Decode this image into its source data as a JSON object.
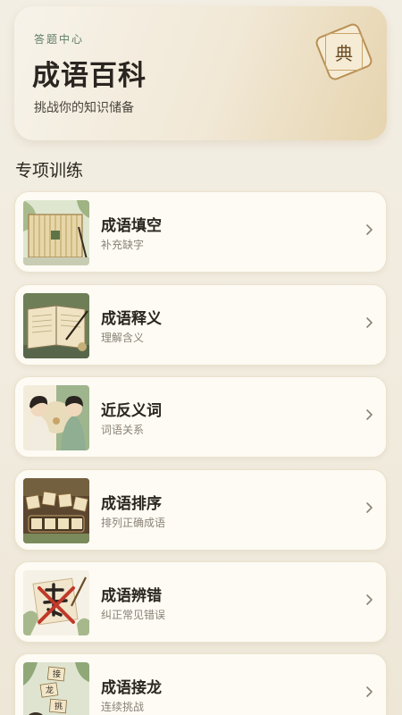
{
  "hero": {
    "kicker": "答题中心",
    "title": "成语百科",
    "subtitle": "挑战你的知识储备",
    "seal_char": "典"
  },
  "section_title": "专项训练",
  "items": [
    {
      "title": "成语填空",
      "subtitle": "补充缺字",
      "icon": "bamboo-scroll-blank-icon"
    },
    {
      "title": "成语释义",
      "subtitle": "理解含义",
      "icon": "open-book-brush-icon"
    },
    {
      "title": "近反义词",
      "subtitle": "词语关系",
      "icon": "two-scholars-icon"
    },
    {
      "title": "成语排序",
      "subtitle": "排列正确成语",
      "icon": "character-tiles-icon"
    },
    {
      "title": "成语辨错",
      "subtitle": "纠正常见错误",
      "icon": "crossed-character-icon"
    },
    {
      "title": "成语接龙",
      "subtitle": "连续挑战",
      "icon": "chained-scrolls-icon"
    }
  ],
  "colors": {
    "background": "#f2ecdf",
    "card": "#fdfbf4",
    "accent_green": "#5f7d66",
    "seal_gold": "#b99056"
  }
}
